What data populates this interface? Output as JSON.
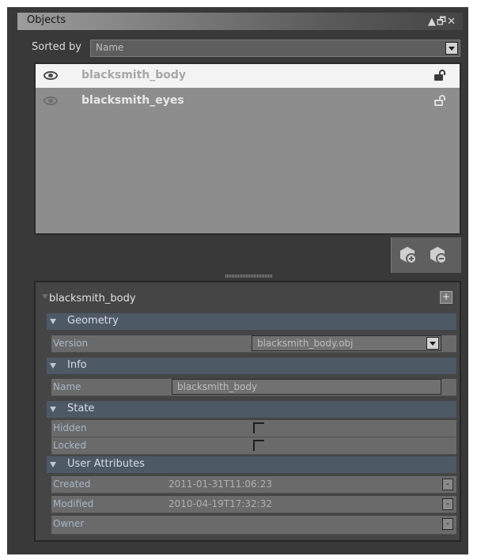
{
  "panel": {
    "title": "Objects",
    "controls": "▲🗗✕"
  },
  "sort": {
    "label": "Sorted by",
    "value": "Name"
  },
  "objects": [
    {
      "name": "blacksmith_body",
      "selected": true
    },
    {
      "name": "blacksmith_eyes",
      "selected": false
    }
  ],
  "properties": {
    "title": "blacksmith_body",
    "plus_label": "+",
    "geometry": {
      "header": "Geometry",
      "version_label": "Version",
      "version_value": "blacksmith_body.obj"
    },
    "info": {
      "header": "Info",
      "name_label": "Name",
      "name_value": "blacksmith_body"
    },
    "state": {
      "header": "State",
      "hidden_label": "Hidden",
      "locked_label": "Locked"
    },
    "user_attributes": {
      "header": "User Attributes",
      "rows": [
        {
          "label": "Created",
          "value": "2011-01-31T11:06:23"
        },
        {
          "label": "Modified",
          "value": "2010-04-19T17:32:32"
        },
        {
          "label": "Owner",
          "value": ""
        }
      ],
      "remove_label": "-"
    }
  }
}
